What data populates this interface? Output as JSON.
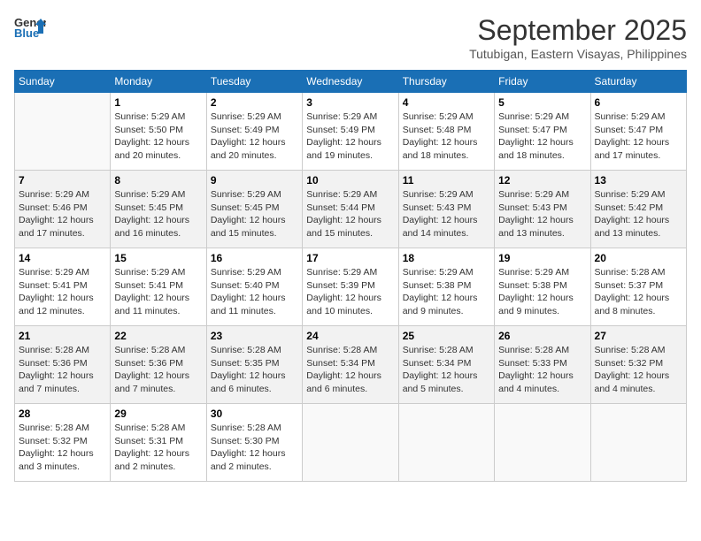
{
  "header": {
    "logo_line1": "General",
    "logo_line2": "Blue",
    "month_year": "September 2025",
    "location": "Tutubigan, Eastern Visayas, Philippines"
  },
  "days_of_week": [
    "Sunday",
    "Monday",
    "Tuesday",
    "Wednesday",
    "Thursday",
    "Friday",
    "Saturday"
  ],
  "weeks": [
    [
      {
        "day": "",
        "info": ""
      },
      {
        "day": "1",
        "info": "Sunrise: 5:29 AM\nSunset: 5:50 PM\nDaylight: 12 hours\nand 20 minutes."
      },
      {
        "day": "2",
        "info": "Sunrise: 5:29 AM\nSunset: 5:49 PM\nDaylight: 12 hours\nand 20 minutes."
      },
      {
        "day": "3",
        "info": "Sunrise: 5:29 AM\nSunset: 5:49 PM\nDaylight: 12 hours\nand 19 minutes."
      },
      {
        "day": "4",
        "info": "Sunrise: 5:29 AM\nSunset: 5:48 PM\nDaylight: 12 hours\nand 18 minutes."
      },
      {
        "day": "5",
        "info": "Sunrise: 5:29 AM\nSunset: 5:47 PM\nDaylight: 12 hours\nand 18 minutes."
      },
      {
        "day": "6",
        "info": "Sunrise: 5:29 AM\nSunset: 5:47 PM\nDaylight: 12 hours\nand 17 minutes."
      }
    ],
    [
      {
        "day": "7",
        "info": "Sunrise: 5:29 AM\nSunset: 5:46 PM\nDaylight: 12 hours\nand 17 minutes."
      },
      {
        "day": "8",
        "info": "Sunrise: 5:29 AM\nSunset: 5:45 PM\nDaylight: 12 hours\nand 16 minutes."
      },
      {
        "day": "9",
        "info": "Sunrise: 5:29 AM\nSunset: 5:45 PM\nDaylight: 12 hours\nand 15 minutes."
      },
      {
        "day": "10",
        "info": "Sunrise: 5:29 AM\nSunset: 5:44 PM\nDaylight: 12 hours\nand 15 minutes."
      },
      {
        "day": "11",
        "info": "Sunrise: 5:29 AM\nSunset: 5:43 PM\nDaylight: 12 hours\nand 14 minutes."
      },
      {
        "day": "12",
        "info": "Sunrise: 5:29 AM\nSunset: 5:43 PM\nDaylight: 12 hours\nand 13 minutes."
      },
      {
        "day": "13",
        "info": "Sunrise: 5:29 AM\nSunset: 5:42 PM\nDaylight: 12 hours\nand 13 minutes."
      }
    ],
    [
      {
        "day": "14",
        "info": "Sunrise: 5:29 AM\nSunset: 5:41 PM\nDaylight: 12 hours\nand 12 minutes."
      },
      {
        "day": "15",
        "info": "Sunrise: 5:29 AM\nSunset: 5:41 PM\nDaylight: 12 hours\nand 11 minutes."
      },
      {
        "day": "16",
        "info": "Sunrise: 5:29 AM\nSunset: 5:40 PM\nDaylight: 12 hours\nand 11 minutes."
      },
      {
        "day": "17",
        "info": "Sunrise: 5:29 AM\nSunset: 5:39 PM\nDaylight: 12 hours\nand 10 minutes."
      },
      {
        "day": "18",
        "info": "Sunrise: 5:29 AM\nSunset: 5:38 PM\nDaylight: 12 hours\nand 9 minutes."
      },
      {
        "day": "19",
        "info": "Sunrise: 5:29 AM\nSunset: 5:38 PM\nDaylight: 12 hours\nand 9 minutes."
      },
      {
        "day": "20",
        "info": "Sunrise: 5:28 AM\nSunset: 5:37 PM\nDaylight: 12 hours\nand 8 minutes."
      }
    ],
    [
      {
        "day": "21",
        "info": "Sunrise: 5:28 AM\nSunset: 5:36 PM\nDaylight: 12 hours\nand 7 minutes."
      },
      {
        "day": "22",
        "info": "Sunrise: 5:28 AM\nSunset: 5:36 PM\nDaylight: 12 hours\nand 7 minutes."
      },
      {
        "day": "23",
        "info": "Sunrise: 5:28 AM\nSunset: 5:35 PM\nDaylight: 12 hours\nand 6 minutes."
      },
      {
        "day": "24",
        "info": "Sunrise: 5:28 AM\nSunset: 5:34 PM\nDaylight: 12 hours\nand 6 minutes."
      },
      {
        "day": "25",
        "info": "Sunrise: 5:28 AM\nSunset: 5:34 PM\nDaylight: 12 hours\nand 5 minutes."
      },
      {
        "day": "26",
        "info": "Sunrise: 5:28 AM\nSunset: 5:33 PM\nDaylight: 12 hours\nand 4 minutes."
      },
      {
        "day": "27",
        "info": "Sunrise: 5:28 AM\nSunset: 5:32 PM\nDaylight: 12 hours\nand 4 minutes."
      }
    ],
    [
      {
        "day": "28",
        "info": "Sunrise: 5:28 AM\nSunset: 5:32 PM\nDaylight: 12 hours\nand 3 minutes."
      },
      {
        "day": "29",
        "info": "Sunrise: 5:28 AM\nSunset: 5:31 PM\nDaylight: 12 hours\nand 2 minutes."
      },
      {
        "day": "30",
        "info": "Sunrise: 5:28 AM\nSunset: 5:30 PM\nDaylight: 12 hours\nand 2 minutes."
      },
      {
        "day": "",
        "info": ""
      },
      {
        "day": "",
        "info": ""
      },
      {
        "day": "",
        "info": ""
      },
      {
        "day": "",
        "info": ""
      }
    ]
  ]
}
